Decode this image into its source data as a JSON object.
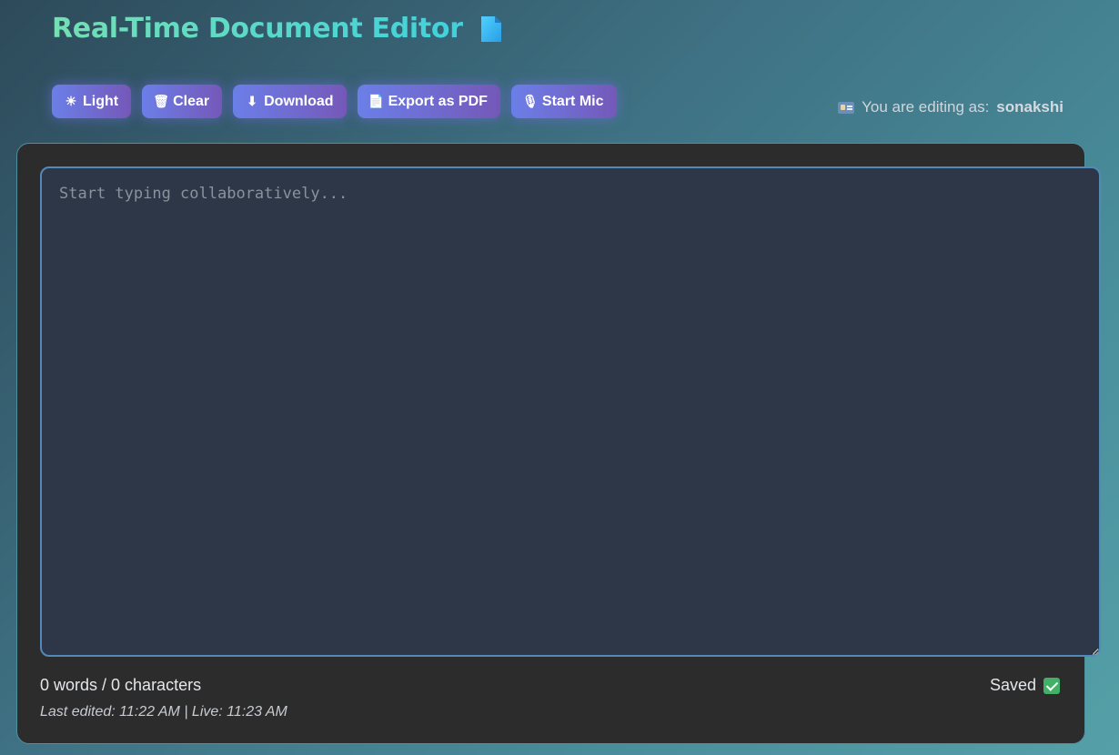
{
  "header": {
    "title": "Real-Time Document Editor",
    "title_icon": "document-icon"
  },
  "toolbar": {
    "buttons": [
      {
        "icon": "sun-icon",
        "glyph": "☀",
        "label": "Light"
      },
      {
        "icon": "trash-icon",
        "glyph": "🗑",
        "label": "Clear"
      },
      {
        "icon": "download-arrow-icon",
        "glyph": "⬇",
        "label": "Download"
      },
      {
        "icon": "pdf-page-icon",
        "glyph": "📄",
        "label": "Export as PDF"
      },
      {
        "icon": "microphone-icon",
        "glyph": "🎙",
        "label": "Start Mic"
      }
    ]
  },
  "user": {
    "prefix": "You are editing as:",
    "name": "sonakshi",
    "icon": "id-card-icon"
  },
  "editor": {
    "placeholder": "Start typing collaboratively...",
    "value": ""
  },
  "status": {
    "word_count_text": "0 words / 0 characters",
    "saved_label": "Saved",
    "saved_icon": "check-mark-icon",
    "timestamps_text": "Last edited: 11:22 AM | Live: 11:23 AM"
  },
  "colors": {
    "accent_start": "#6b7fe8",
    "accent_end": "#7558b8",
    "panel_bg": "#2c2c2d",
    "editor_bg": "#2d3748",
    "editor_border": "#5389b8",
    "title_gradient_start": "#74e0b3",
    "title_gradient_end": "#3ccfe0",
    "saved_check": "#43b067"
  }
}
